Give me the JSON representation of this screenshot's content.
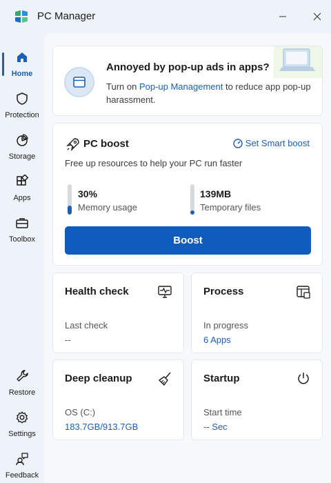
{
  "app": {
    "title": "PC Manager",
    "logo_icon": "pc-manager-logo",
    "minimize_icon": "minimize-icon",
    "close_icon": "close-icon"
  },
  "sidebar": {
    "items": [
      {
        "label": "Home",
        "icon": "home-icon",
        "active": true
      },
      {
        "label": "Protection",
        "icon": "shield-icon",
        "active": false
      },
      {
        "label": "Storage",
        "icon": "pie-chart-icon",
        "active": false
      },
      {
        "label": "Apps",
        "icon": "apps-grid-icon",
        "active": false
      },
      {
        "label": "Toolbox",
        "icon": "toolbox-icon",
        "active": false
      }
    ],
    "bottom_items": [
      {
        "label": "Restore",
        "icon": "wrench-icon"
      },
      {
        "label": "Settings",
        "icon": "gear-icon"
      },
      {
        "label": "Feedback",
        "icon": "feedback-icon"
      }
    ]
  },
  "banner": {
    "title": "Annoyed by pop-up ads in apps?",
    "text_before": "Turn on ",
    "link": "Pop-up Management",
    "text_after": " to reduce app pop-up harassment.",
    "icon": "popup-window-icon"
  },
  "boost": {
    "title": "PC boost",
    "icon": "rocket-icon",
    "smart_boost_label": "Set Smart boost",
    "smart_boost_icon": "gauge-icon",
    "subtitle": "Free up resources to help your PC run faster",
    "memory": {
      "value": "30%",
      "label": "Memory usage",
      "level": 0.3
    },
    "temp": {
      "value": "139MB",
      "label": "Temporary files",
      "level": 0.12
    },
    "button": "Boost"
  },
  "tiles": {
    "health": {
      "title": "Health check",
      "label": "Last check",
      "value": "--",
      "icon": "monitor-pulse-icon"
    },
    "process": {
      "title": "Process",
      "label": "In progress",
      "value": "6 Apps",
      "icon": "window-process-icon"
    },
    "cleanup": {
      "title": "Deep cleanup",
      "label": "OS (C:)",
      "value": "183.7GB/913.7GB",
      "icon": "broom-icon"
    },
    "startup": {
      "title": "Startup",
      "label": "Start time",
      "value": "-- Sec",
      "icon": "power-icon"
    }
  },
  "colors": {
    "accent": "#0f5cbd",
    "link": "#1a5fb4",
    "background": "#eef3f9"
  }
}
